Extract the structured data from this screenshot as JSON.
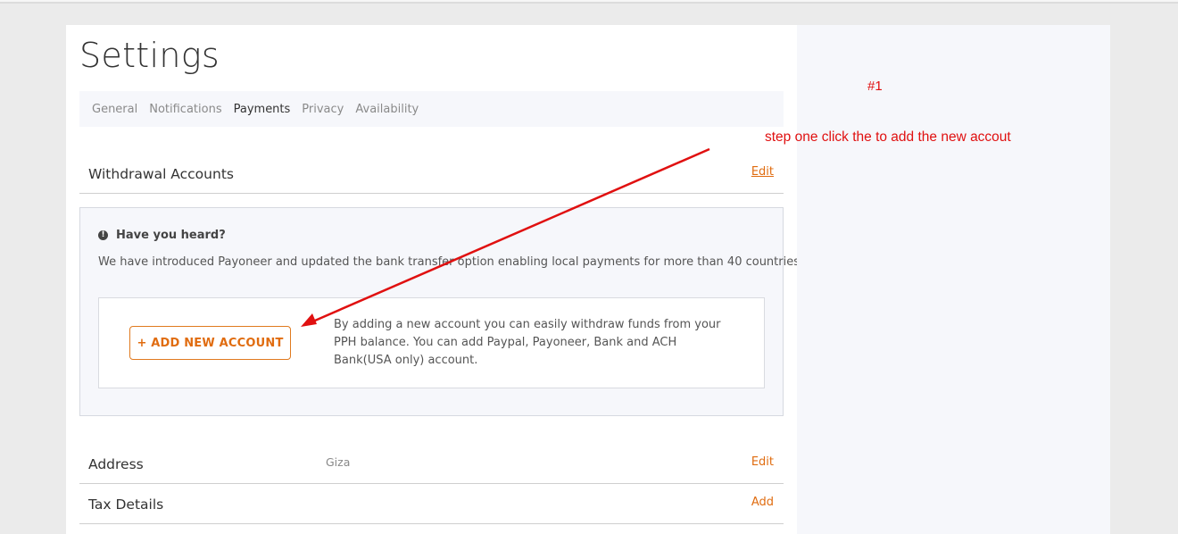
{
  "page": {
    "title": "Settings"
  },
  "tabs": [
    {
      "label": "General",
      "active": false
    },
    {
      "label": "Notifications",
      "active": false
    },
    {
      "label": "Payments",
      "active": true
    },
    {
      "label": "Privacy",
      "active": false
    },
    {
      "label": "Availability",
      "active": false
    }
  ],
  "withdrawal": {
    "title": "Withdrawal Accounts",
    "edit_label": "Edit",
    "notice_title": "Have you heard?",
    "notice_text": "We have introduced Payoneer and updated the bank transfer option enabling local payments for more than 40 countries.",
    "add_button_label": "+ ADD NEW ACCOUNT",
    "add_description": "By adding a new account you can easily withdraw funds from your PPH balance. You can add Paypal, Payoneer, Bank and ACH Bank(USA only) account."
  },
  "address": {
    "title": "Address",
    "value": "Giza",
    "edit_label": "Edit"
  },
  "tax": {
    "title": "Tax Details",
    "add_label": "Add"
  },
  "annotation": {
    "number": "#1",
    "text": "step one click the to add the new accout",
    "color": "#e01010"
  },
  "colors": {
    "accent": "#e06c10",
    "tab_bar_bg": "#f6f7fb"
  },
  "icons": {
    "notice": "exclamation-circle-icon",
    "annotation": "arrow"
  }
}
